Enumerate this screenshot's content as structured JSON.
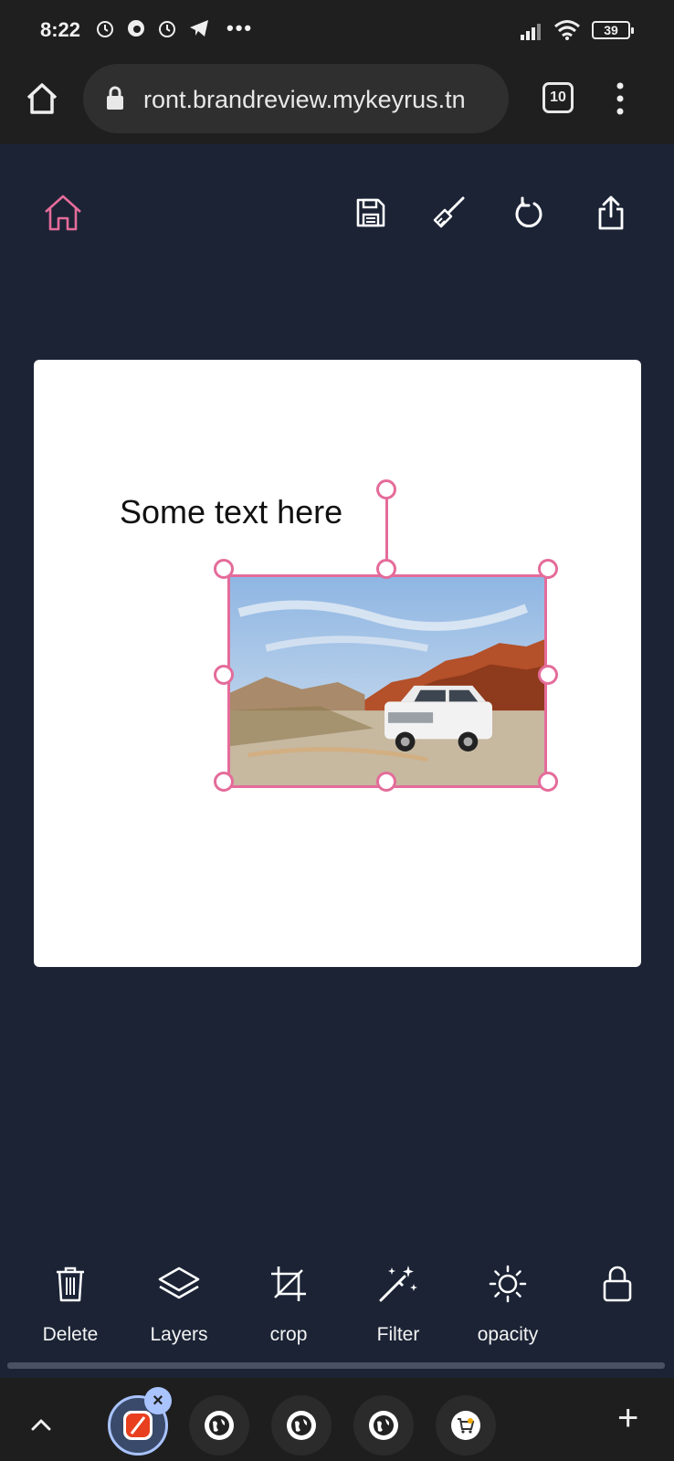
{
  "status_bar": {
    "time": "8:22",
    "battery": "39",
    "overflow": "•••"
  },
  "browser": {
    "url": "ront.brandreview.mykeyrus.tn",
    "tab_count": "10"
  },
  "header": {
    "icons": [
      "home-icon",
      "save-icon",
      "brush-icon",
      "refresh-icon",
      "share-icon"
    ],
    "accent_color": "#e46c9a"
  },
  "canvas": {
    "text_element": "Some text here",
    "selection_color": "#e46c9a",
    "image_description_icon": "white-suv-photo"
  },
  "toolbar": {
    "tools": [
      {
        "label": "Delete",
        "icon": "trash-icon"
      },
      {
        "label": "Layers",
        "icon": "layers-icon"
      },
      {
        "label": "crop",
        "icon": "crop-icon"
      },
      {
        "label": "Filter",
        "icon": "magic-wand-icon"
      },
      {
        "label": "opacity",
        "icon": "sun-icon"
      },
      {
        "label": "",
        "icon": "lock-icon"
      }
    ]
  },
  "tab_strip": {
    "close_label": "×",
    "add_label": "+"
  },
  "colors": {
    "background": "#1b2335",
    "chrome": "#1f1f1f",
    "accent": "#e46c9a"
  }
}
